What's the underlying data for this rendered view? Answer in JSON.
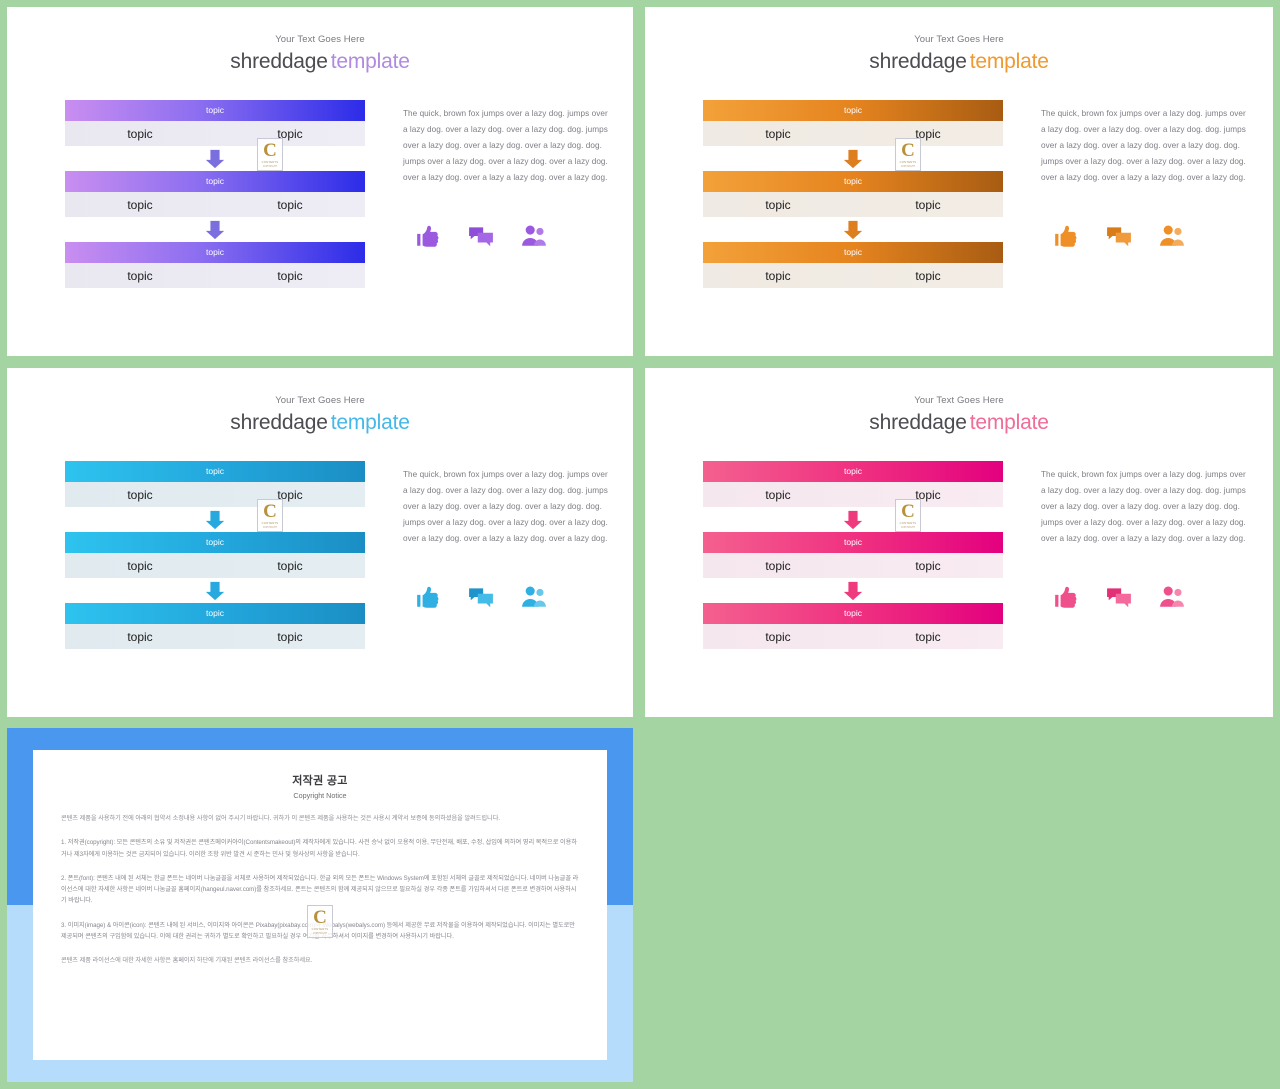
{
  "page": {
    "background_color": "#a4d4a2",
    "slide_background": "#ffffff"
  },
  "common": {
    "eyebrow": "Your Text Goes Here",
    "title_main": "shreddage",
    "title_accent": "template",
    "topic_label": "topic",
    "body_copy": "The quick, brown fox jumps over a lazy dog. jumps over a lazy dog. over a lazy dog. over a lazy dog. dog. jumps over a lazy dog. over a lazy dog. over a lazy dog. dog. jumps over a lazy dog. over a lazy dog. over a lazy dog. over a lazy dog. over a lazy a lazy dog. over a lazy dog.",
    "icons": [
      "thumbs-up-icon",
      "chat-bubbles-icon",
      "people-icon"
    ],
    "watermark_letter": "C",
    "watermark_sub": "CONTENTS",
    "watermark_sub2": "COPYRIGHT"
  },
  "slides": [
    {
      "id": "slide-purple",
      "position": "top-left",
      "accent_color": "#b08ae0",
      "bar_gradient_from": "#c98ef0",
      "bar_gradient_to": "#2c2ce8",
      "sub_bar_from": "#e9e7ef",
      "sub_bar_to": "#eeecf4",
      "arrow_color": "#7b6fe0",
      "icon_color": "#9b59e0"
    },
    {
      "id": "slide-orange",
      "position": "top-right",
      "accent_color": "#ef9930",
      "bar_gradient_from": "#f3a13a",
      "bar_gradient_to": "#a85c12",
      "sub_bar_from": "#efeae3",
      "sub_bar_to": "#f2ece4",
      "arrow_color": "#dd7f1e",
      "icon_color": "#ef8f28"
    },
    {
      "id": "slide-blue",
      "position": "bottom-left",
      "accent_color": "#44b8e8",
      "bar_gradient_from": "#2ec3ef",
      "bar_gradient_to": "#1a8ec4",
      "sub_bar_from": "#e0eaef",
      "sub_bar_to": "#e4eef2",
      "arrow_color": "#27a8de",
      "icon_color": "#2fafe2"
    },
    {
      "id": "slide-pink",
      "position": "bottom-right",
      "accent_color": "#ef6c96",
      "bar_gradient_from": "#f4608f",
      "bar_gradient_to": "#e3007f",
      "sub_bar_from": "#f5e7ee",
      "sub_bar_to": "#f8ebf1",
      "arrow_color": "#ef3a7e",
      "icon_color": "#ef4f8a"
    }
  ],
  "copyright_slide": {
    "frame_color": "#4a97f0",
    "frame_color_lower": "#b5dcfa",
    "title": "저작권 공고",
    "subtitle": "Copyright Notice",
    "paragraphs": [
      "콘텐츠 제품을 사용하기 전에 아래의 협약서 소정내용 사항이 없어 주시기 바랍니다. 귀하가 이 콘텐츠 제품을 사용하는 것은 사용시 계약서 보증에 동의하셨음을 알려드립니다.",
      "1. 저작권(copyright): 모든 콘텐츠의 소유 및 저작권은 콘텐츠메이커아이(Contentsmakeout)의 제작자에게 있습니다. 사전 승낙 없이 오용적 이용, 무단전재, 배포, 수정, 삽입에 의하여 영리 목적으로 이용하거나 제3자에게 이용하는 것은 금지되어 있습니다. 이러한 조항 위반 발견 시 준하는 민사 및 형사상의 사항을 받습니다.",
      "2. 폰트(font): 콘텐츠 내에 된 서체는 한글 폰트는 네이버 나눔글꼴을 서체로 사용하여 제작되었습니다. 한글 외의 모든 폰트는 Windows System에 포함된 서체의 글꼴로 제작되었습니다. 네이버 나눔글꼴 라이선스에 대한 자세한 사항은 네이버 나눔글꼴 홈페이지(hangeul.naver.com)를 참조하세요. 폰트는 콘텐츠의 함께 제공되지 않으므로 필요하실 경우 각종 폰트를 가입하셔서 다른 폰트로 변경하여 사용하시기 바랍니다.",
      "3. 이미지(image) & 아이콘(icon): 콘텐츠 내에 된 서비스, 이미지와 아이콘은 Pixabay(pixabay.com)와 Webalys(webalys.com) 등에서 제공한 무료 저작물을 이용하여 제작되었습니다. 이미지는 별도로만 제공되며 콘텐츠의 구입함에 있습니다. 이에 대한 권리는 귀하가 별도로 확인하고 필요하실 경우 여기를 사무하셔서 이미지를 변경하여 사용하시기 바랍니다.",
      "콘텐츠 제품 라이선스에 대한 자세한 사항은 홈페이지 하단에 기재된 콘텐츠 라이선스를 참조하세요."
    ]
  }
}
